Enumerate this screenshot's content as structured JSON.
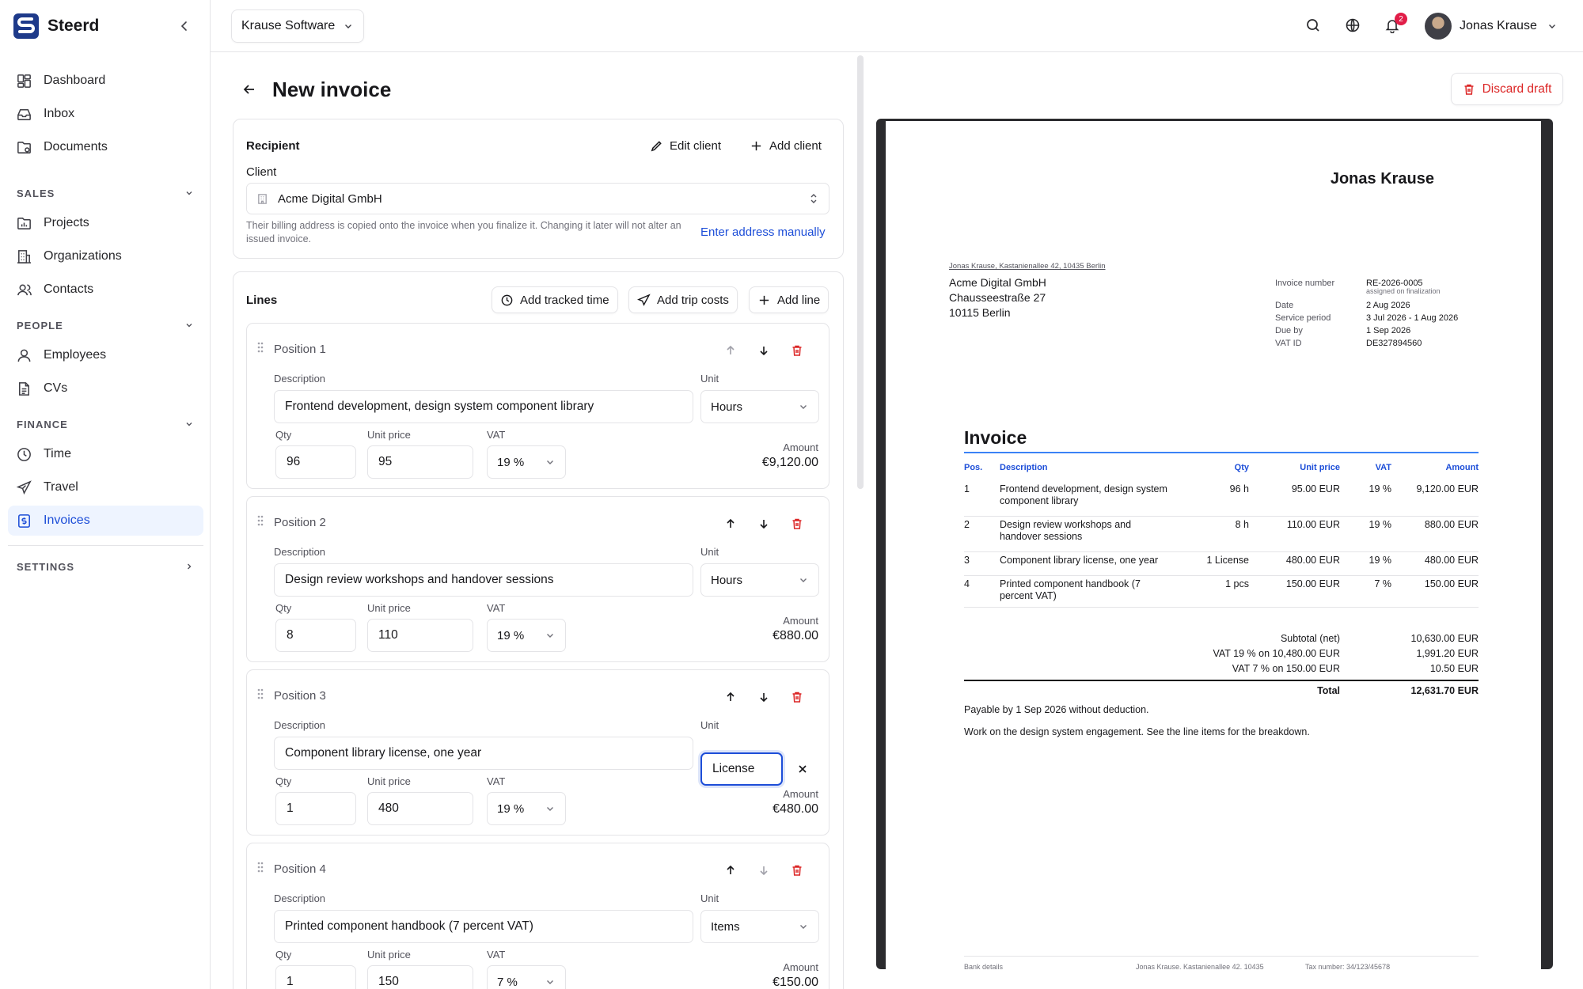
{
  "app": {
    "name": "Steerd"
  },
  "sidebar": {
    "main": [
      {
        "label": "Dashboard"
      },
      {
        "label": "Inbox"
      },
      {
        "label": "Documents"
      }
    ],
    "sales": {
      "title": "SALES",
      "items": [
        {
          "label": "Projects"
        },
        {
          "label": "Organizations"
        },
        {
          "label": "Contacts"
        }
      ]
    },
    "people": {
      "title": "PEOPLE",
      "items": [
        {
          "label": "Employees"
        },
        {
          "label": "CVs"
        }
      ]
    },
    "finance": {
      "title": "FINANCE",
      "items": [
        {
          "label": "Time"
        },
        {
          "label": "Travel"
        },
        {
          "label": "Invoices"
        }
      ]
    },
    "settings": {
      "title": "SETTINGS"
    },
    "active": "Invoices"
  },
  "topbar": {
    "org": "Krause Software",
    "notifications": "2",
    "user": "Jonas Krause"
  },
  "page": {
    "title": "New invoice"
  },
  "recipient": {
    "title": "Recipient",
    "edit": "Edit client",
    "add": "Add client",
    "client_label": "Client",
    "client": "Acme Digital GmbH",
    "hint": "Their billing address is copied onto the invoice when you finalize it. Changing it later will not alter an issued invoice.",
    "manual": "Enter address manually"
  },
  "lines": {
    "title": "Lines",
    "add_time": "Add tracked time",
    "add_trip": "Add trip costs",
    "add_line": "Add line",
    "labels": {
      "description": "Description",
      "unit": "Unit",
      "qty": "Qty",
      "unit_price": "Unit price",
      "vat": "VAT",
      "amount": "Amount"
    },
    "positions": [
      {
        "title": "Position 1",
        "description": "Frontend development, design system component library",
        "unit": "Hours",
        "qty": "96",
        "price": "95",
        "vat": "19 %",
        "amount": "€9,120.00"
      },
      {
        "title": "Position 2",
        "description": "Design review workshops and handover sessions",
        "unit": "Hours",
        "qty": "8",
        "price": "110",
        "vat": "19 %",
        "amount": "€880.00"
      },
      {
        "title": "Position 3",
        "description": "Component library license, one year",
        "unit": "License",
        "qty": "1",
        "price": "480",
        "vat": "19 %",
        "amount": "€480.00"
      },
      {
        "title": "Position 4",
        "description": "Printed component handbook (7 percent VAT)",
        "unit": "Items",
        "qty": "1",
        "price": "150",
        "vat": "7 %",
        "amount": "€150.00"
      }
    ]
  },
  "preview": {
    "discard": "Discard draft",
    "sender_name": "Jonas Krause",
    "sender_line": "Jonas Krause, Kastanienallee 42, 10435 Berlin",
    "address": [
      "Acme Digital GmbH",
      "Chausseestraße 27",
      "10115 Berlin"
    ],
    "meta": [
      {
        "k": "Invoice number",
        "v": "RE-2026-0005",
        "note": "assigned on finalization"
      },
      {
        "k": "Date",
        "v": "2 Aug 2026"
      },
      {
        "k": "Service period",
        "v": "3 Jul 2026 - 1 Aug 2026"
      },
      {
        "k": "Due by",
        "v": "1 Sep 2026"
      },
      {
        "k": "VAT ID",
        "v": "DE327894560"
      }
    ],
    "heading": "Invoice",
    "cols": [
      "Pos.",
      "Description",
      "Qty",
      "Unit price",
      "VAT",
      "Amount"
    ],
    "rows": [
      {
        "pos": "1",
        "desc": "Frontend development, design system component library",
        "qty": "96 h",
        "price": "95.00 EUR",
        "vat": "19 %",
        "amount": "9,120.00 EUR"
      },
      {
        "pos": "2",
        "desc": "Design review workshops and handover sessions",
        "qty": "8 h",
        "price": "110.00 EUR",
        "vat": "19 %",
        "amount": "880.00 EUR"
      },
      {
        "pos": "3",
        "desc": "Component library license, one year",
        "qty": "1 License",
        "price": "480.00 EUR",
        "vat": "19 %",
        "amount": "480.00 EUR"
      },
      {
        "pos": "4",
        "desc": "Printed component handbook (7 percent VAT)",
        "qty": "1 pcs",
        "price": "150.00 EUR",
        "vat": "7 %",
        "amount": "150.00 EUR"
      }
    ],
    "totals": [
      {
        "k": "Subtotal (net)",
        "v": "10,630.00 EUR"
      },
      {
        "k": "VAT 19 % on 10,480.00 EUR",
        "v": "1,991.20 EUR"
      },
      {
        "k": "VAT 7 % on 150.00 EUR",
        "v": "10.50 EUR"
      }
    ],
    "total": {
      "k": "Total",
      "v": "12,631.70 EUR"
    },
    "payable": "Payable by 1 Sep 2026 without deduction.",
    "note": "Work on the design system engagement. See the line items for the breakdown.",
    "footer": [
      "Bank details",
      "Jonas Krause, Kastanienallee 42, 10435",
      "Tax number: 34/123/45678"
    ]
  },
  "colors": {
    "accent": "#1d4ed8",
    "danger": "#dc2626",
    "active_bg": "#eef4ff"
  }
}
